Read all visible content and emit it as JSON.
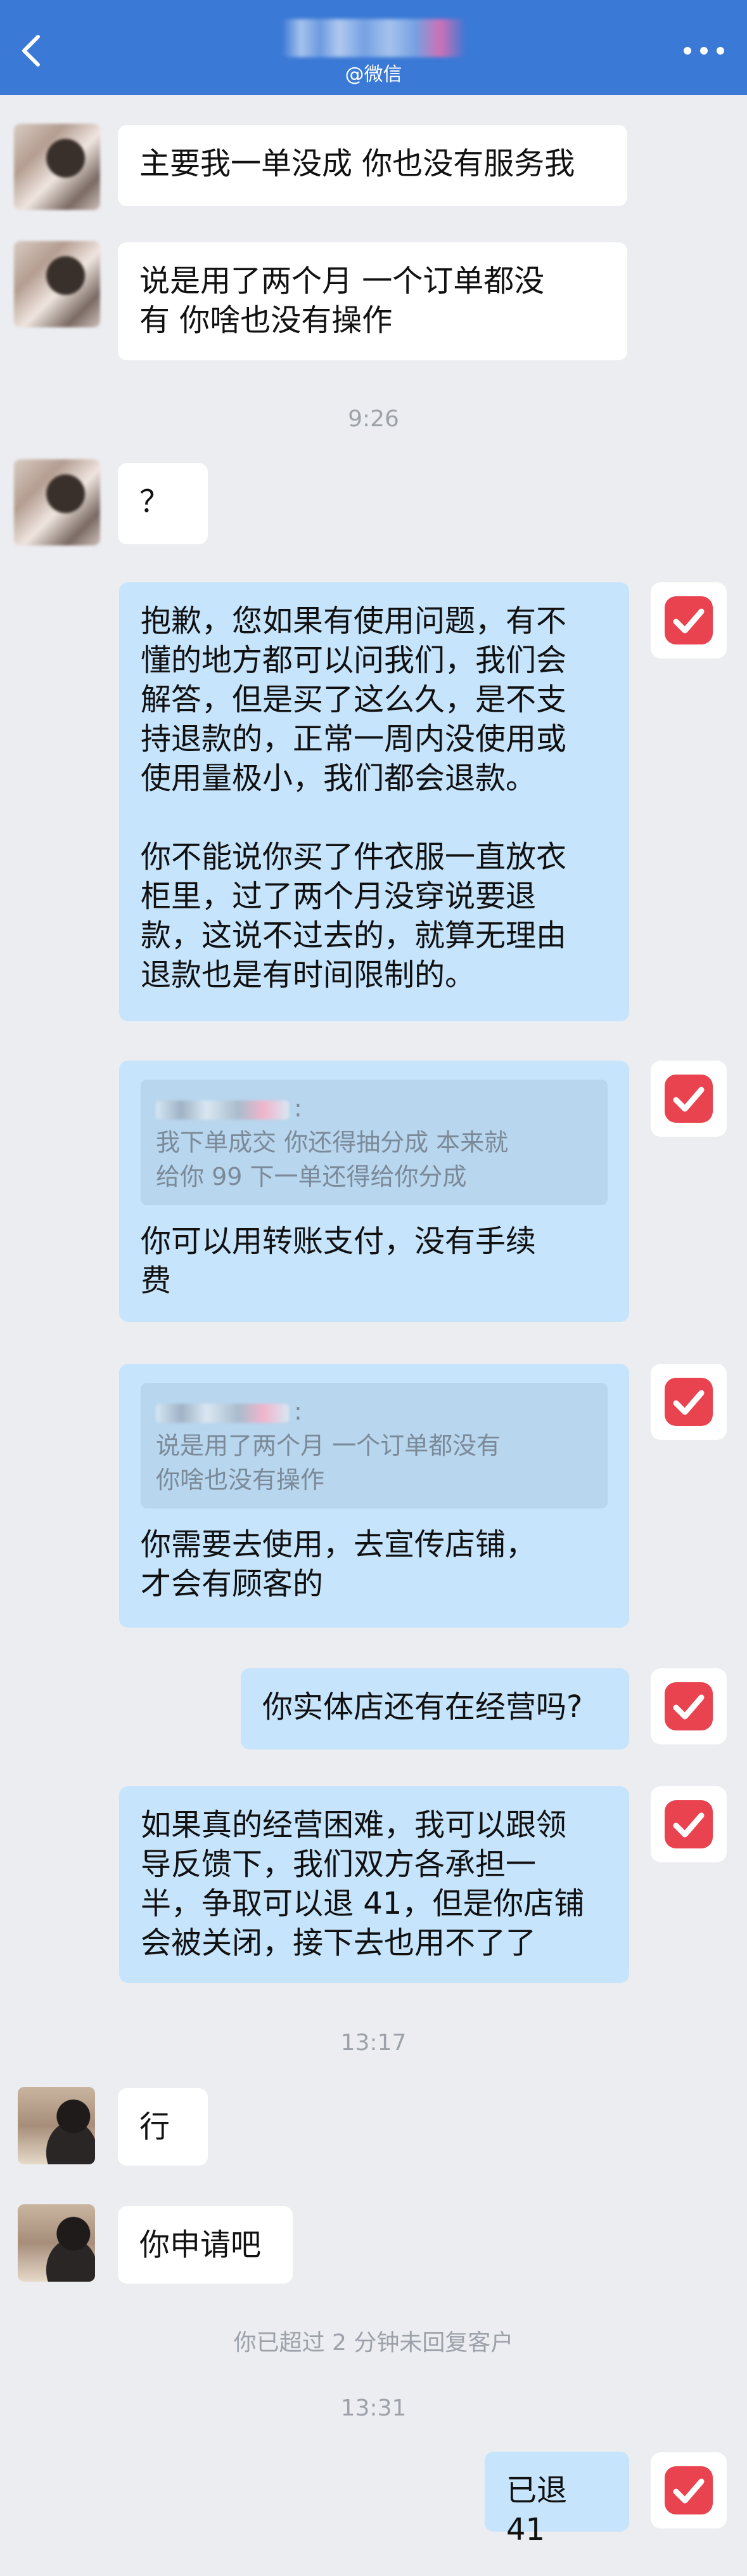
{
  "header": {
    "subtitle": "@微信",
    "back_icon": "chevron-left-icon",
    "more_icon": "more-dots-icon"
  },
  "colors": {
    "header_bg": "#3B79D6",
    "chat_bg": "#ECEDF1",
    "incoming_bubble": "#FFFFFF",
    "outgoing_bubble": "#C6E4FC",
    "badge_red": "#E8434F"
  },
  "messages": {
    "m1": "主要我一单没成 你也没有服务我",
    "m2_l1": "说是用了两个月  一个订单都没",
    "m2_l2": "有  你啥也没有操作",
    "t1": "9:26",
    "m3": "？",
    "m4_l1": "抱歉，您如果有使用问题，有不",
    "m4_l2": "懂的地方都可以问我们，我们会",
    "m4_l3": "解答，但是买了这么久，是不支",
    "m4_l4": "持退款的，正常一周内没使用或",
    "m4_l5": "使用量极小，我们都会退款。",
    "m4_l6": "你不能说你买了件衣服一直放衣",
    "m4_l7": "柜里，过了两个月没穿说要退",
    "m4_l8": "款，这说不过去的，就算无理由",
    "m4_l9": "退款也是有时间限制的。",
    "q1_colon": ":",
    "q1_l1": "我下单成交  你还得抽分成 本来就",
    "q1_l2": "给你 99 下一单还得给你分成",
    "m5_l1": "你可以用转账支付，没有手续",
    "m5_l2": "费",
    "q2_colon": ":",
    "q2_l1": "说是用了两个月  一个订单都没有",
    "q2_l2": "你啥也没有操作",
    "m6_l1": "你需要去使用，去宣传店铺，",
    "m6_l2": "才会有顾客的",
    "m7": "你实体店还有在经营吗?",
    "m8_l1": "如果真的经营困难，我可以跟领",
    "m8_l2": "导反馈下，我们双方各承担一",
    "m8_l3": "半，争取可以退 41，但是你店铺",
    "m8_l4": "会被关闭，接下去也用不了了",
    "t2": "13:17",
    "m9": "行",
    "m10": "你申请吧",
    "sys1": "你已超过 2 分钟未回复客户",
    "t3": "13:31",
    "m11": "已退 41"
  }
}
